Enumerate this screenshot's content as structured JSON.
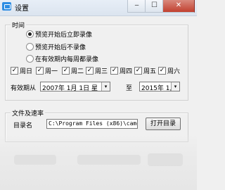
{
  "window": {
    "title": "设置",
    "min_glyph": "‒",
    "max_glyph": "☐",
    "close_glyph": "✕"
  },
  "time_group": {
    "legend": "时间",
    "radio_options": [
      {
        "label": "预览开始后立即录像",
        "checked": true
      },
      {
        "label": "预览开始后不录像",
        "checked": false
      },
      {
        "label": "在有效期内每周都录像",
        "checked": false
      }
    ],
    "weekdays": [
      {
        "label": "周日",
        "checked": true
      },
      {
        "label": "周一",
        "checked": true
      },
      {
        "label": "周二",
        "checked": true
      },
      {
        "label": "周三",
        "checked": true
      },
      {
        "label": "周四",
        "checked": true
      },
      {
        "label": "周五",
        "checked": true
      },
      {
        "label": "周六",
        "checked": true
      }
    ],
    "valid_period_label": "有效期从",
    "start_date": "2007年 1月 1日 星",
    "to_label": "至",
    "end_date": "2015年 1月 1日 星",
    "dropdown_glyph": "▾",
    "check_glyph": "✓"
  },
  "file_group": {
    "legend": "文件及速率",
    "dir_label": "目录名",
    "dir_value": "C:\\Program Files (x86)\\camera",
    "open_dir_button": "打开目录"
  }
}
